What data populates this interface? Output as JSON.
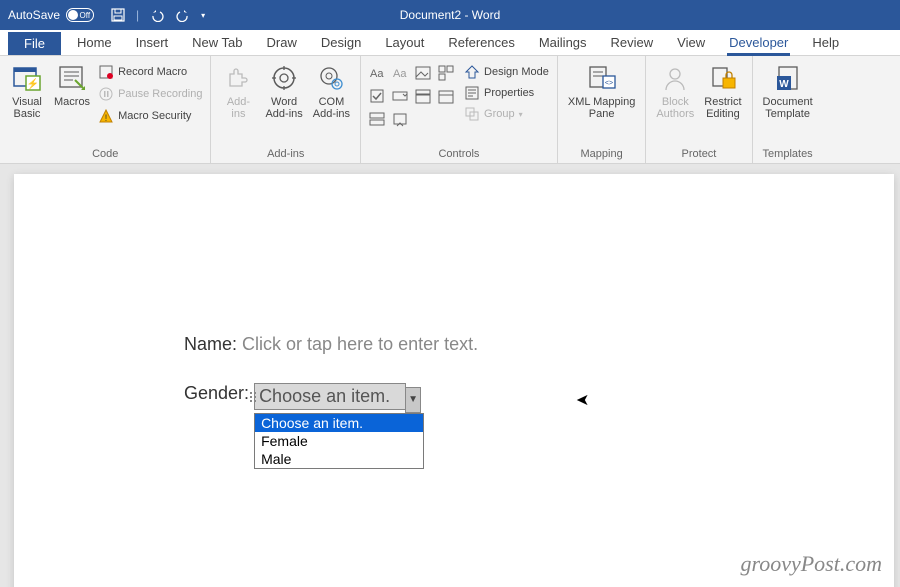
{
  "title": {
    "autosave_label": "AutoSave",
    "autosave_state": "Off",
    "doc_title": "Document2 - Word"
  },
  "tabs": {
    "file": "File",
    "home": "Home",
    "insert": "Insert",
    "newtab": "New Tab",
    "draw": "Draw",
    "design": "Design",
    "layout": "Layout",
    "references": "References",
    "mailings": "Mailings",
    "review": "Review",
    "view": "View",
    "developer": "Developer",
    "help": "Help"
  },
  "ribbon": {
    "groups": {
      "code": {
        "label": "Code",
        "visual_basic": "Visual\nBasic",
        "macros": "Macros",
        "record": "Record Macro",
        "pause": "Pause Recording",
        "security": "Macro Security"
      },
      "addins": {
        "label": "Add-ins",
        "addins_btn": "Add-\nins",
        "word_addins": "Word\nAdd-ins",
        "com_addins": "COM\nAdd-ins"
      },
      "controls": {
        "label": "Controls",
        "design_mode": "Design Mode",
        "properties": "Properties",
        "group": "Group"
      },
      "mapping": {
        "label": "Mapping",
        "xml_mapping": "XML Mapping\nPane"
      },
      "protect": {
        "label": "Protect",
        "block_authors": "Block\nAuthors",
        "restrict": "Restrict\nEditing"
      },
      "templates": {
        "label": "Templates",
        "doc_template": "Document\nTemplate"
      }
    }
  },
  "doc": {
    "name_label": "Name:",
    "name_placeholder": "Click or tap here to enter text.",
    "gender_label": "Gender:",
    "combo_value": "Choose an item.",
    "options": [
      "Choose an item.",
      "Female",
      "Male"
    ]
  },
  "watermark": "groovyPost.com"
}
